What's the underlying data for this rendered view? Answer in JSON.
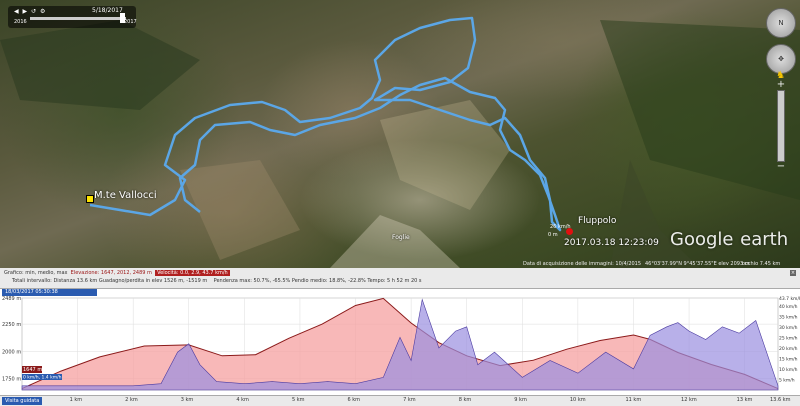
{
  "map": {
    "timeline": {
      "date": "5/18/2017",
      "start_year": "2016",
      "end_year": "2017",
      "controls": "◀ ▶ ↺ ⚙"
    },
    "labels": {
      "summit": "M.te Vallocci",
      "town": "Fluppolo",
      "datetime": "2017.03.18 12:23:09",
      "place": "Foglie",
      "speed": "26 km/h",
      "small": "0 m"
    },
    "logo": {
      "brand": "Google",
      "product": "earth"
    },
    "status": {
      "acquisition": "Data di acquisizione delle immagini: 10/4/2015",
      "coords": "46°03'37.99\"N   9°45'37.55\"E  elev  2093 m",
      "eye": "occhio  7.45 km"
    },
    "nav": {
      "north": "N",
      "plus": "+",
      "minus": "−"
    },
    "track_color": "#5ba6e6"
  },
  "elevation_profile": {
    "toolbar": {
      "row1": "Grafico:   min, medio, max",
      "elevation": "Elevazione: 1647, 2012, 2489 m",
      "speed": "Velocità: 0.0, 2.9, 43.7 km/h",
      "row2": "Totali intervallo:  Distanza  13.6 km     Guadagno/perdita in elev  1526 m, -1519 m",
      "slopes": "Pendenza max: 50.7%, -65.5%   Pendio medio: 18.8%, -22.8%   Tempo: 5 h 52 m 20 s",
      "close": "×"
    },
    "date": "18/03/2017 05:30:38",
    "footer": {
      "guided_tour": "Visita guidata"
    },
    "cursor_readout": "1647 m",
    "cursor_speed": "0 km/h, 1.4 km/h"
  },
  "chart_data": {
    "type": "area",
    "xlabel": "",
    "ylabel": "",
    "x_unit": "km",
    "x_ticks": [
      "1 km",
      "2 km",
      "3 km",
      "4 km",
      "5 km",
      "6 km",
      "7 km",
      "8 km",
      "9 km",
      "10 km",
      "11 km",
      "12 km",
      "13 km",
      "13.6 km"
    ],
    "x_range": [
      0,
      13.6
    ],
    "y_left_ticks": [
      "2489 m",
      "2250 m",
      "2000 m",
      "1750 m",
      "1647 m"
    ],
    "y_left_range": [
      1647,
      2489
    ],
    "y_right_ticks": [
      "43.7 km/h",
      "40 km/h",
      "35 km/h",
      "30 km/h",
      "25 km/h",
      "20 km/h",
      "15 km/h",
      "10 km/h",
      "5 km/h"
    ],
    "y_right_range": [
      0,
      43.7
    ],
    "series": [
      {
        "name": "Elevazione",
        "color": "#f5a0a0",
        "x": [
          0,
          0.7,
          1.4,
          2.2,
          3.0,
          3.6,
          4.2,
          4.8,
          5.4,
          6.0,
          6.5,
          7.0,
          7.5,
          8.0,
          8.6,
          9.2,
          9.8,
          10.4,
          11.0,
          11.3,
          11.8,
          12.4,
          13.0,
          13.6
        ],
        "values": [
          1660,
          1820,
          1950,
          2050,
          2060,
          1960,
          1970,
          2120,
          2250,
          2420,
          2485,
          2260,
          2080,
          1960,
          1870,
          1920,
          2020,
          2100,
          2150,
          2110,
          1990,
          1880,
          1790,
          1660
        ]
      },
      {
        "name": "Velocità",
        "color": "#9a8ee0",
        "x": [
          0,
          1.0,
          2.0,
          2.5,
          2.8,
          3.0,
          3.2,
          3.5,
          4.0,
          4.5,
          5.0,
          5.5,
          6.0,
          6.5,
          6.8,
          7.0,
          7.2,
          7.5,
          7.8,
          8.0,
          8.2,
          8.5,
          9.0,
          9.5,
          10.0,
          10.5,
          11.0,
          11.3,
          11.6,
          11.8,
          12.0,
          12.3,
          12.6,
          12.9,
          13.2,
          13.6
        ],
        "values": [
          2,
          2,
          2,
          3,
          18,
          22,
          12,
          4,
          3,
          4,
          3,
          4,
          3,
          6,
          25,
          14,
          43,
          20,
          28,
          30,
          12,
          18,
          6,
          14,
          8,
          18,
          10,
          26,
          30,
          32,
          28,
          24,
          30,
          27,
          33,
          2
        ]
      }
    ]
  }
}
